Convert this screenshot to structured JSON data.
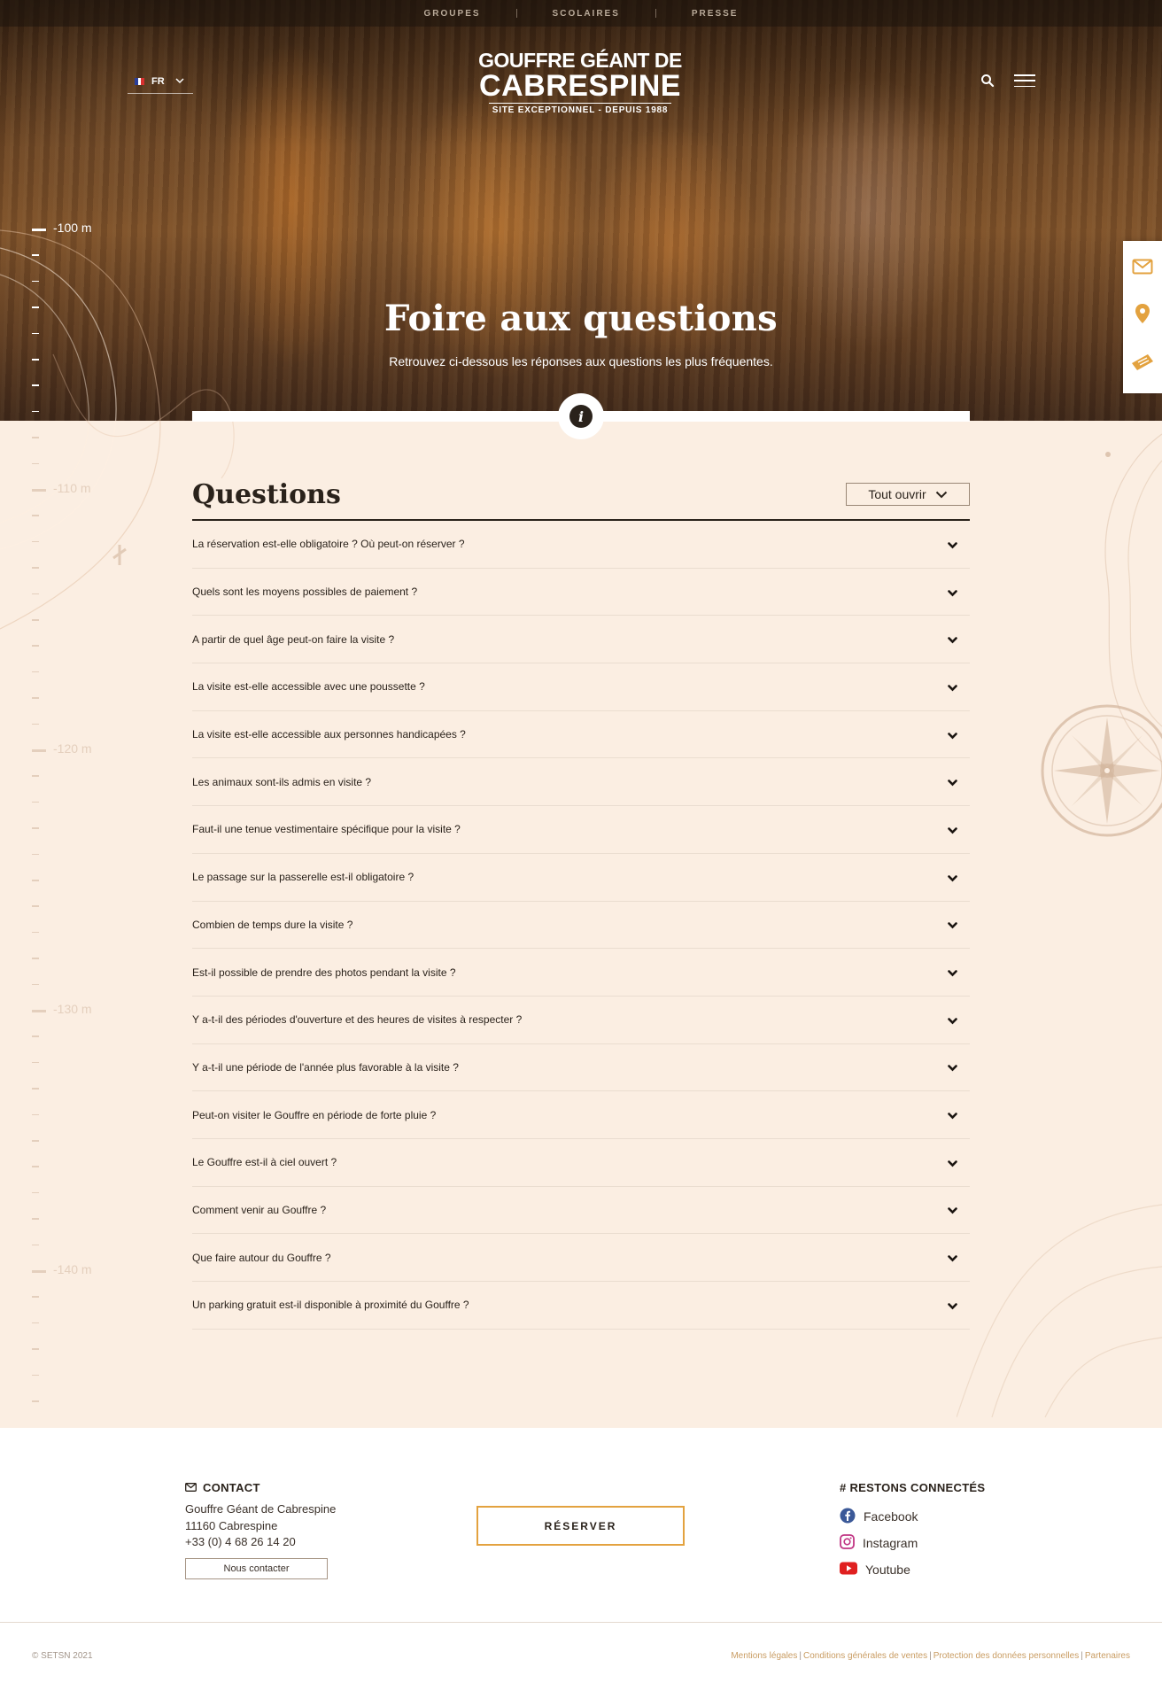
{
  "topnav": {
    "items": [
      "GROUPES",
      "SCOLAIRES",
      "PRESSE"
    ]
  },
  "language": {
    "code": "FR"
  },
  "logo": {
    "line1": "GOUFFRE GÉANT DE",
    "line2": "CABRESPINE",
    "line3": "SITE EXCEPTIONNEL - DEPUIS 1988"
  },
  "hero": {
    "title": "Foire aux questions",
    "subtitle": "Retrouvez ci-dessous les réponses aux questions les plus fréquentes."
  },
  "depth_gauge": {
    "labels": [
      "-100 m",
      "-110 m",
      "-120 m",
      "-130 m",
      "-140 m"
    ]
  },
  "faq": {
    "title": "Questions",
    "open_all_label": "Tout ouvrir",
    "questions": [
      "La réservation est-elle obligatoire ? Où peut-on réserver ?",
      "Quels sont les moyens possibles de paiement ?",
      "A partir de quel âge peut-on faire la visite ?",
      "La visite est-elle accessible avec une poussette ?",
      "La visite est-elle accessible aux personnes handicapées ?",
      "Les animaux sont-ils admis en visite ?",
      "Faut-il une tenue vestimentaire spécifique pour la visite ?",
      "Le passage sur la passerelle est-il obligatoire ?",
      "Combien de temps dure la visite ?",
      "Est-il possible de prendre des photos pendant la visite ?",
      "Y a-t-il des périodes d'ouverture et des heures de visites à respecter ?",
      "Y a-t-il une période de l'année plus favorable à la visite ?",
      "Peut-on visiter le Gouffre en période de forte pluie ?",
      "Le Gouffre est-il à ciel ouvert ?",
      "Comment venir au Gouffre ?",
      "Que faire autour du Gouffre ?",
      "Un parking gratuit est-il disponible à proximité du Gouffre ?"
    ]
  },
  "footer": {
    "contact": {
      "title": "CONTACT",
      "name": "Gouffre Géant de Cabrespine",
      "city": "11160 Cabrespine",
      "phone": "+33 (0) 4 68 26 14 20",
      "button": "Nous contacter"
    },
    "reserve_button": "RÉSERVER",
    "social": {
      "title": "# RESTONS CONNECTÉS",
      "items": [
        "Facebook",
        "Instagram",
        "Youtube"
      ]
    },
    "copyright": "© SETSN 2021",
    "legal_links": [
      "Mentions légales",
      "Conditions générales de ventes",
      "Protection des données personnelles",
      "Partenaires"
    ]
  },
  "colors": {
    "accent": "#e3a23f",
    "background": "#fbeee2",
    "text": "#2a221b"
  },
  "icons": {
    "search": "search-icon",
    "menu": "menu-icon",
    "info": "info-icon",
    "mail": "mail-icon",
    "pin": "map-pin-icon",
    "ticket": "ticket-icon",
    "chevron": "chevron-down-icon"
  }
}
